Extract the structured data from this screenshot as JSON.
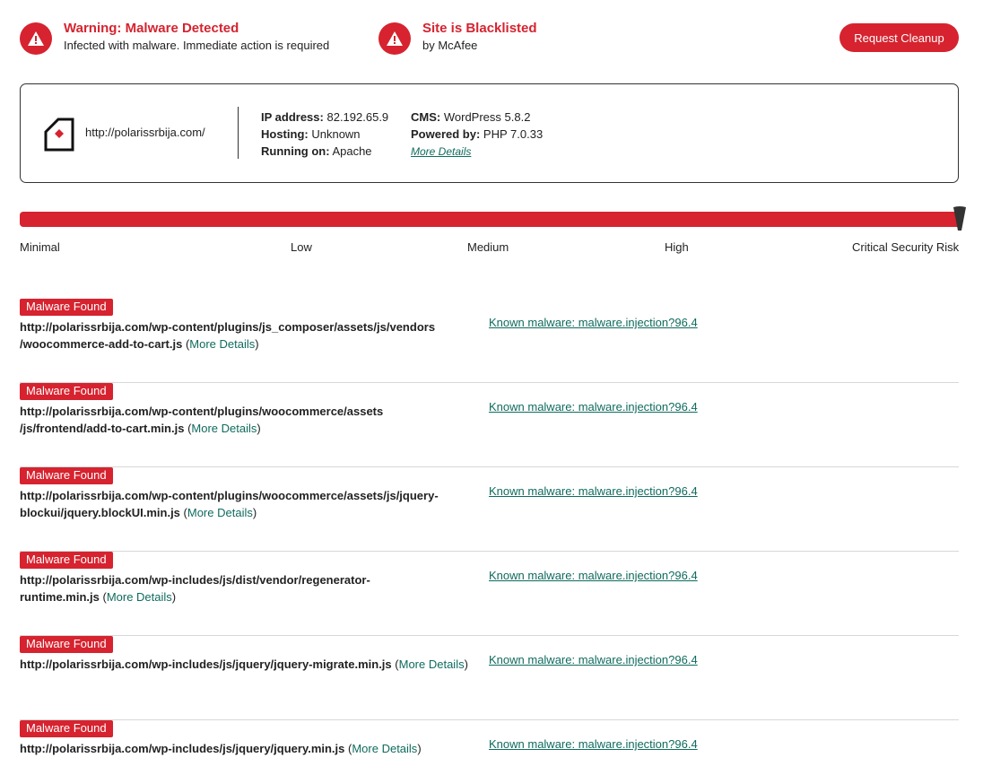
{
  "alerts": [
    {
      "title": "Warning: Malware Detected",
      "subtitle": "Infected with malware. Immediate action is required",
      "icon": "warning-icon"
    },
    {
      "title": "Site is Blacklisted",
      "subtitle": "by McAfee",
      "icon": "warning-icon"
    }
  ],
  "cleanup_button": "Request Cleanup",
  "site": {
    "url": "http://polarissrbija.com/",
    "icon": "site-icon",
    "ip_label": "IP address:",
    "ip_value": "82.192.65.9",
    "hosting_label": "Hosting:",
    "hosting_value": "Unknown",
    "running_label": "Running on:",
    "running_value": "Apache",
    "cms_label": "CMS:",
    "cms_value": "WordPress 5.8.2",
    "powered_label": "Powered by:",
    "powered_value": "PHP 7.0.33",
    "more_details": "More Details"
  },
  "risk": {
    "labels": [
      "Minimal",
      "Low",
      "Medium",
      "High",
      "Critical Security Risk"
    ],
    "level_fraction": 1.0,
    "bar_color": "#d6232f"
  },
  "malware": {
    "badge": "Malware Found",
    "more_details": "More Details",
    "items": [
      {
        "line1": "http://polarissrbija.com/wp-content/plugins/js_composer/assets/js/vendors",
        "line2": "/woocommerce-add-to-cart.js",
        "known": "Known malware: malware.injection?96.4"
      },
      {
        "line1": "http://polarissrbija.com/wp-content/plugins/woocommerce/assets",
        "line2": "/js/frontend/add-to-cart.min.js",
        "known": "Known malware: malware.injection?96.4"
      },
      {
        "line1": "http://polarissrbija.com/wp-content/plugins/woocommerce/assets/js/jquery-",
        "line2": "blockui/jquery.blockUI.min.js",
        "known": "Known malware: malware.injection?96.4"
      },
      {
        "line1": "http://polarissrbija.com/wp-includes/js/dist/vendor/regenerator-",
        "line2": "runtime.min.js",
        "known": "Known malware: malware.injection?96.4"
      },
      {
        "line1": "http://polarissrbija.com/wp-includes/js/jquery/jquery-migrate.min.js",
        "line2": "",
        "known": "Known malware: malware.injection?96.4"
      },
      {
        "line1": "http://polarissrbija.com/wp-includes/js/jquery/jquery.min.js",
        "line2": "",
        "known": "Known malware: malware.injection?96.4"
      }
    ]
  },
  "colors": {
    "accent": "#d6232f",
    "link": "#0f6b5e"
  }
}
